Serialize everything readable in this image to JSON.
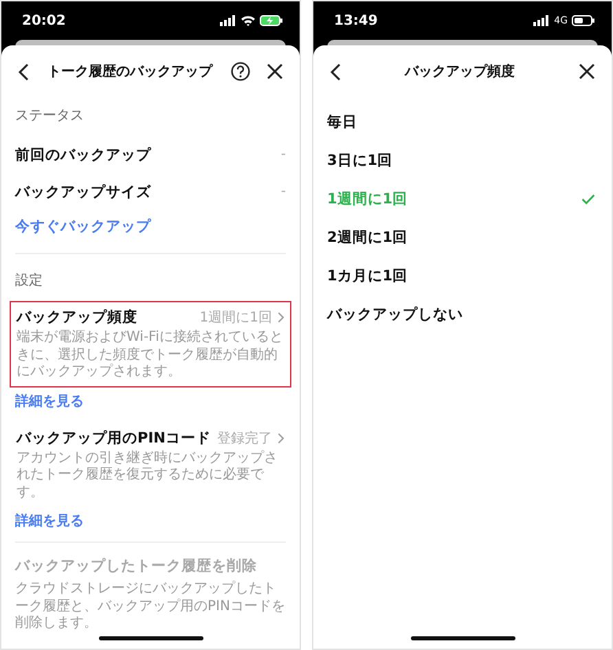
{
  "left_screen": {
    "time": "20:02",
    "title": "トーク履歴のバックアップ",
    "status_section": {
      "heading": "ステータス",
      "rows": [
        {
          "label": "前回のバックアップ",
          "value": "-"
        },
        {
          "label": "バックアップサイズ",
          "value": "-"
        }
      ],
      "action": "今すぐバックアップ"
    },
    "settings_section": {
      "heading": "設定",
      "items": [
        {
          "label": "バックアップ頻度",
          "value": "1週間に1回",
          "description": "端末が電源およびWi-Fiに接続されているときに、選択した頻度でトーク履歴が自動的にバックアップされます。",
          "highlighted": true,
          "link": "詳細を見る"
        },
        {
          "label": "バックアップ用のPINコード",
          "value": "登録完了",
          "description": "アカウントの引き継ぎ時にバックアップされたトーク履歴を復元するために必要です。",
          "highlighted": false,
          "link": "詳細を見る"
        }
      ]
    },
    "delete": {
      "label": "バックアップしたトーク履歴を削除",
      "disabled": true,
      "description": "クラウドストレージにバックアップしたトーク履歴と、バックアップ用のPINコードを削除します。"
    }
  },
  "right_screen": {
    "time": "13:49",
    "network": "4G",
    "title": "バックアップ頻度",
    "options": [
      {
        "label": "毎日",
        "selected": false
      },
      {
        "label": "3日に1回",
        "selected": false
      },
      {
        "label": "1週間に1回",
        "selected": true
      },
      {
        "label": "2週間に1回",
        "selected": false
      },
      {
        "label": "1カ月に1回",
        "selected": false
      },
      {
        "label": "バックアップしない",
        "selected": false
      }
    ]
  }
}
